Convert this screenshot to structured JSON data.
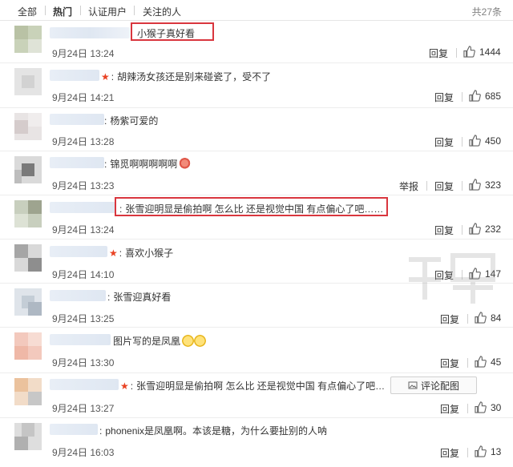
{
  "tabs": {
    "all": "全部",
    "hot": "热门",
    "verified": "认证用户",
    "following": "关注的人"
  },
  "total": "共27条",
  "actions": {
    "reply": "回复",
    "report": "举报",
    "view_image": "评论配图"
  },
  "comments": [
    {
      "text": "小猴子真好看",
      "time": "9月24日 13:24",
      "likes": "1444"
    },
    {
      "text": "胡辣汤女孩还是别来碰瓷了，受不了",
      "time": "9月24日 14:21",
      "likes": "685"
    },
    {
      "text": "杨紫可爱的",
      "time": "9月24日 13:28",
      "likes": "450"
    },
    {
      "text": "锦觅啊啊啊啊啊",
      "time": "9月24日 13:23",
      "likes": "323"
    },
    {
      "text": "张雪迎明显是偷拍啊 怎么比 还是视觉中国 有点偏心了吧……",
      "time": "9月24日 13:24",
      "likes": "232"
    },
    {
      "text": "喜欢小猴子",
      "time": "9月24日 14:10",
      "likes": "147"
    },
    {
      "text": "张雪迎真好看",
      "time": "9月24日 13:25",
      "likes": "84"
    },
    {
      "text": "图片写的是凤凰",
      "time": "9月24日 13:30",
      "likes": "45"
    },
    {
      "text": "张雪迎明显是偷拍啊 怎么比 还是视觉中国 有点偏心了吧…",
      "time": "9月24日 13:27",
      "likes": "30"
    },
    {
      "text": "phonenix是凤凰啊。本该是糖，为什么要扯别的人呐",
      "time": "9月24日 16:03",
      "likes": "13"
    }
  ],
  "colors": {
    "highlight": "#d9363e",
    "star": "#e94223",
    "divider": "#ededed"
  },
  "icons": {
    "like": "thumbs-up-icon",
    "star": "star-icon",
    "image": "image-icon"
  }
}
